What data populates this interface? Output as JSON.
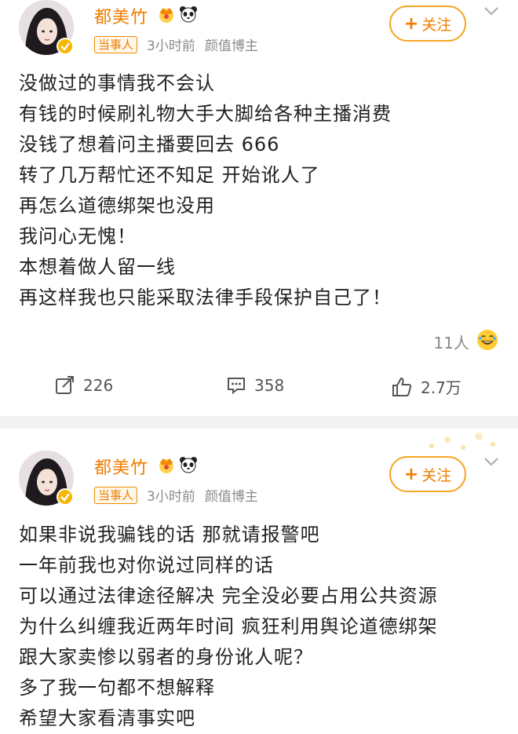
{
  "posts": [
    {
      "username": "都美竹",
      "tag": "当事人",
      "time": "3小时前",
      "title": "颜值博主",
      "follow_label": "关注",
      "lines": [
        "没做过的事情我不会认",
        "有钱的时候刷礼物大手大脚给各种主播消费",
        "没钱了想着问主播要回去 666",
        "转了几万帮忙还不知足 开始讹人了",
        "再怎么道德绑架也没用",
        "我问心无愧！",
        "本想着做人留一线",
        "再这样我也只能采取法律手段保护自己了！"
      ],
      "reaction_count": "11人",
      "repost_count": "226",
      "comment_count": "358",
      "like_count": "2.7万"
    },
    {
      "username": "都美竹",
      "tag": "当事人",
      "time": "3小时前",
      "title": "颜值博主",
      "follow_label": "关注",
      "lines": [
        "如果非说我骗钱的话 那就请报警吧",
        "一年前我也对你说过同样的话",
        "可以通过法律途径解决 完全没必要占用公共资源",
        "为什么纠缠我近两年时间 疯狂利用舆论道德绑架",
        "跟大家卖惨以弱者的身份讹人呢？",
        "多了我一句都不想解释",
        "希望大家看清事实吧"
      ]
    }
  ],
  "colors": {
    "accent": "#f07d00",
    "follow_border": "#f5a623",
    "divider": "#f2f2f2"
  },
  "icons": [
    "crown-icon",
    "panda-icon",
    "verified-icon",
    "chevron-down-icon",
    "repost-icon",
    "comment-icon",
    "like-icon",
    "laugh-emoji-icon"
  ]
}
